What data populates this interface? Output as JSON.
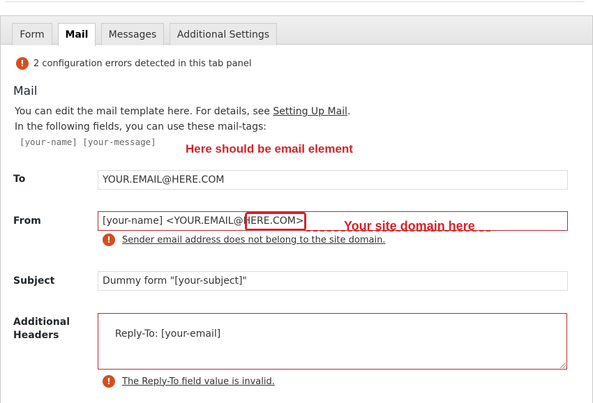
{
  "tabs": [
    {
      "label": "Form",
      "active": false
    },
    {
      "label": "Mail",
      "active": true
    },
    {
      "label": "Messages",
      "active": false
    },
    {
      "label": "Additional Settings",
      "active": false
    }
  ],
  "error_summary": "2 configuration errors detected in this tab panel",
  "section": {
    "title": "Mail",
    "desc_prefix": "You can edit the mail template here. For details, see ",
    "desc_link": "Setting Up Mail",
    "desc_suffix": ".",
    "desc_line2": "In the following fields, you can use these mail-tags:",
    "mail_tags": "[your-name] [your-message]"
  },
  "annotations": {
    "email_element": "Here should be email element",
    "site_domain": "Your site domain here",
    "accent_color": "#d8232a"
  },
  "fields": {
    "to": {
      "label": "To",
      "value": "YOUR.EMAIL@HERE.COM"
    },
    "from": {
      "label": "From",
      "value": "[your-name] <YOUR.EMAIL@HERE.COM>",
      "error": "Sender email address does not belong to the site domain."
    },
    "subject": {
      "label": "Subject",
      "value": "Dummy form \"[your-subject]\""
    },
    "additional_headers": {
      "label_line1": "Additional",
      "label_line2": "Headers",
      "value": "Reply-To: [your-email]",
      "error": "The Reply-To field value is invalid."
    }
  },
  "icons": {
    "error": "exclamation-circle-icon",
    "error_glyph": "!",
    "error_color": "#d54e21"
  }
}
